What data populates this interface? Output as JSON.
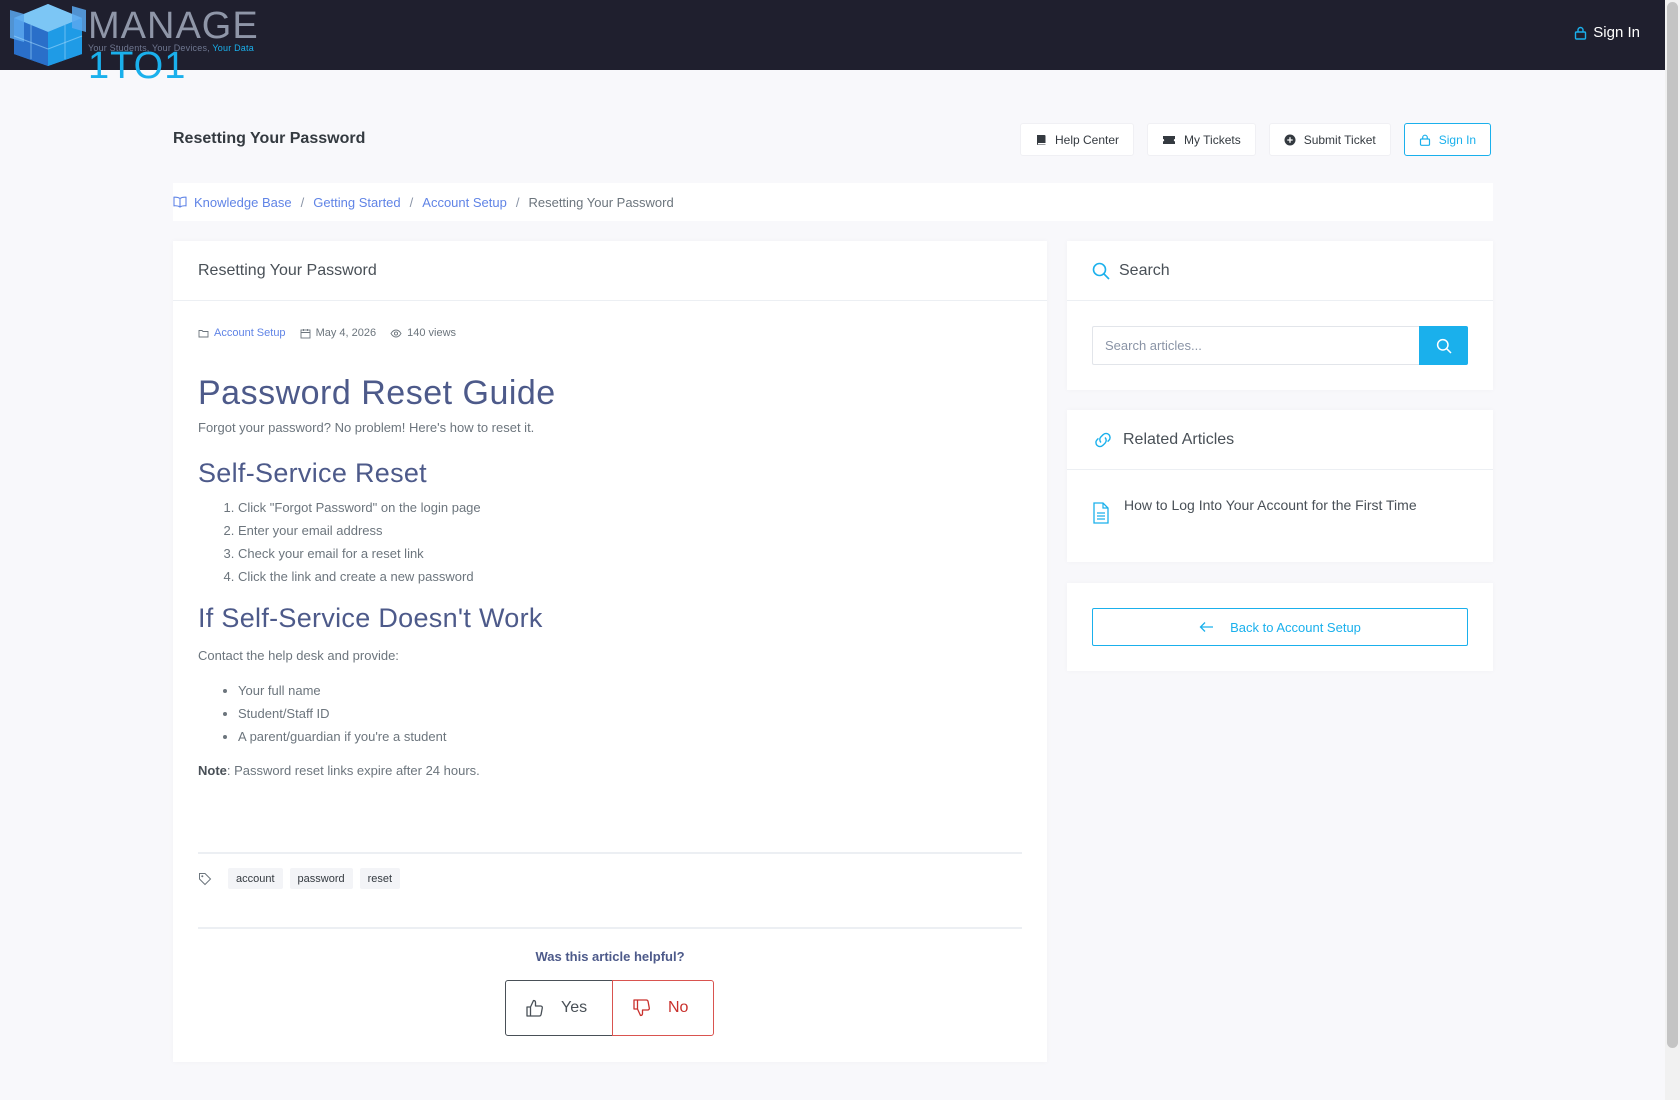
{
  "brand": {
    "name_main": "MANAGE",
    "name_accent": "1TO1",
    "tagline_main": "Your Students, Your Devices,",
    "tagline_accent": "Your Data"
  },
  "topbar": {
    "signin_label": "Sign In"
  },
  "page": {
    "title": "Resetting Your Password"
  },
  "header_actions": {
    "help_center": "Help Center",
    "my_tickets": "My Tickets",
    "submit_ticket": "Submit Ticket",
    "sign_in": "Sign In"
  },
  "breadcrumb": {
    "items": [
      "Knowledge Base",
      "Getting Started",
      "Account Setup"
    ],
    "current": "Resetting Your Password"
  },
  "article": {
    "card_title": "Resetting Your Password",
    "category": "Account Setup",
    "date": "May 4, 2026",
    "views": "140 views",
    "h1": "Password Reset Guide",
    "intro": "Forgot your password? No problem! Here's how to reset it.",
    "h2_self": "Self-Service Reset",
    "steps": [
      "Click \"Forgot Password\" on the login page",
      "Enter your email address",
      "Check your email for a reset link",
      "Click the link and create a new password"
    ],
    "h2_fail": "If Self-Service Doesn't Work",
    "contact": "Contact the help desk and provide:",
    "provide": [
      "Your full name",
      "Student/Staff ID",
      "A parent/guardian if you're a student"
    ],
    "note_label": "Note",
    "note_text": ": Password reset links expire after 24 hours.",
    "tags": [
      "account",
      "password",
      "reset"
    ],
    "helpful_question": "Was this article helpful?",
    "vote_yes": "Yes",
    "vote_no": "No"
  },
  "sidebar": {
    "search_title": "Search",
    "search_placeholder": "Search articles...",
    "related_title": "Related Articles",
    "related": [
      "How to Log Into Your Account for the First Time"
    ],
    "back_label": "Back to Account Setup"
  },
  "colors": {
    "topbar": "#1f1f2e",
    "accent": "#1ab0ec",
    "link": "#6084e6",
    "heading": "#4d5a8a",
    "no_red": "#c9302c"
  },
  "icons": [
    "lock-icon",
    "book-icon",
    "ticket-icon",
    "plus-circle-icon",
    "folder-icon",
    "calendar-icon",
    "eye-icon",
    "tag-icon",
    "thumbs-up-icon",
    "thumbs-down-icon",
    "search-icon",
    "link-icon",
    "document-icon",
    "arrow-left-icon"
  ]
}
